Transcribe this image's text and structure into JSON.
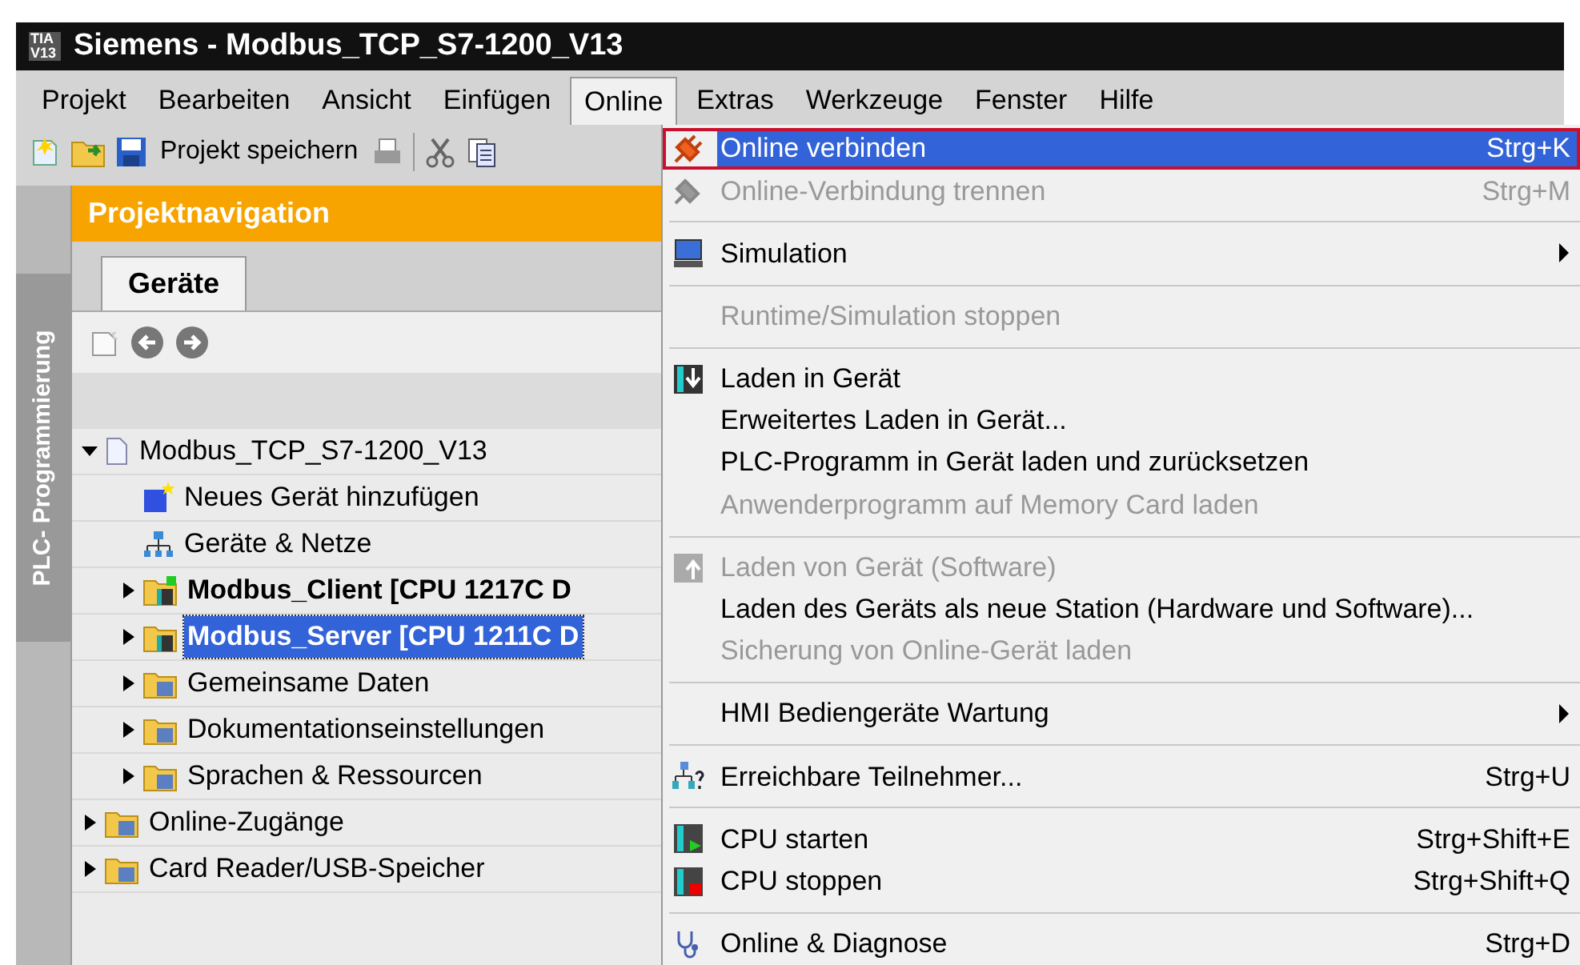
{
  "window": {
    "title": "Siemens - Modbus_TCP_S7-1200_V13",
    "logo": "TIA V13"
  },
  "menubar": [
    {
      "label": "Projekt",
      "selected": false
    },
    {
      "label": "Bearbeiten",
      "selected": false
    },
    {
      "label": "Ansicht",
      "selected": false
    },
    {
      "label": "Einfügen",
      "selected": false
    },
    {
      "label": "Online",
      "selected": true
    },
    {
      "label": "Extras",
      "selected": false
    },
    {
      "label": "Werkzeuge",
      "selected": false
    },
    {
      "label": "Fenster",
      "selected": false
    },
    {
      "label": "Hilfe",
      "selected": false
    }
  ],
  "toolbar": {
    "save_label": "Projekt speichern"
  },
  "side_tab": "PLC- Programmierung",
  "panel": {
    "title": "Projektnavigation",
    "tabs": [
      {
        "label": "Geräte",
        "selected": true
      }
    ]
  },
  "tree": [
    {
      "label": "Modbus_TCP_S7-1200_V13",
      "kind": "project",
      "expanded": true,
      "selected": false,
      "children": [
        {
          "label": "Neues Gerät hinzufügen",
          "kind": "add",
          "selected": false
        },
        {
          "label": "Geräte & Netze",
          "kind": "network",
          "selected": false
        },
        {
          "label": "Modbus_Client [CPU 1217C D",
          "kind": "device",
          "expanded": false,
          "selected": false
        },
        {
          "label": "Modbus_Server [CPU 1211C D",
          "kind": "device",
          "expanded": false,
          "selected": true
        },
        {
          "label": "Gemeinsame Daten",
          "kind": "folder",
          "expanded": false,
          "selected": false
        },
        {
          "label": "Dokumentationseinstellungen",
          "kind": "folder",
          "expanded": false,
          "selected": false
        },
        {
          "label": "Sprachen & Ressourcen",
          "kind": "folder",
          "expanded": false,
          "selected": false
        }
      ]
    },
    {
      "label": "Online-Zugänge",
      "kind": "folder",
      "expanded": false,
      "selected": false
    },
    {
      "label": "Card Reader/USB-Speicher",
      "kind": "folder",
      "expanded": false,
      "selected": false
    }
  ],
  "menu": [
    {
      "kind": "item",
      "label": "Online verbinden",
      "shortcut": "Strg+K",
      "selected": true,
      "disabled": false
    },
    {
      "kind": "item",
      "label": "Online-Verbindung trennen",
      "shortcut": "Strg+M",
      "selected": false,
      "disabled": true
    },
    {
      "kind": "separator"
    },
    {
      "kind": "item",
      "label": "Simulation",
      "selected": false,
      "disabled": false,
      "submenu": true
    },
    {
      "kind": "separator"
    },
    {
      "kind": "item",
      "label": "Runtime/Simulation stoppen",
      "selected": false,
      "disabled": true
    },
    {
      "kind": "separator"
    },
    {
      "kind": "item",
      "label": "Laden in Gerät",
      "selected": false,
      "disabled": false
    },
    {
      "kind": "item",
      "label": "Erweitertes Laden in Gerät...",
      "selected": false,
      "disabled": false
    },
    {
      "kind": "item",
      "label": "PLC-Programm in Gerät laden und zurücksetzen",
      "selected": false,
      "disabled": false
    },
    {
      "kind": "item",
      "label": "Anwenderprogramm auf Memory Card laden",
      "selected": false,
      "disabled": true
    },
    {
      "kind": "separator"
    },
    {
      "kind": "item",
      "label": "Laden von Gerät (Software)",
      "selected": false,
      "disabled": true
    },
    {
      "kind": "item",
      "label": "Laden des Geräts als neue Station (Hardware und Software)...",
      "selected": false,
      "disabled": false
    },
    {
      "kind": "item",
      "label": "Sicherung von Online-Gerät laden",
      "selected": false,
      "disabled": true
    },
    {
      "kind": "separator"
    },
    {
      "kind": "item",
      "label": "HMI Bediengeräte Wartung",
      "selected": false,
      "disabled": false,
      "submenu": true
    },
    {
      "kind": "separator"
    },
    {
      "kind": "item",
      "label": "Erreichbare Teilnehmer...",
      "shortcut": "Strg+U",
      "selected": false,
      "disabled": false
    },
    {
      "kind": "separator"
    },
    {
      "kind": "item",
      "label": "CPU starten",
      "shortcut": "Strg+Shift+E",
      "selected": false,
      "disabled": false
    },
    {
      "kind": "item",
      "label": "CPU stoppen",
      "shortcut": "Strg+Shift+Q",
      "selected": false,
      "disabled": false
    },
    {
      "kind": "separator"
    },
    {
      "kind": "item",
      "label": "Online & Diagnose",
      "shortcut": "Strg+D",
      "selected": false,
      "disabled": false
    }
  ]
}
